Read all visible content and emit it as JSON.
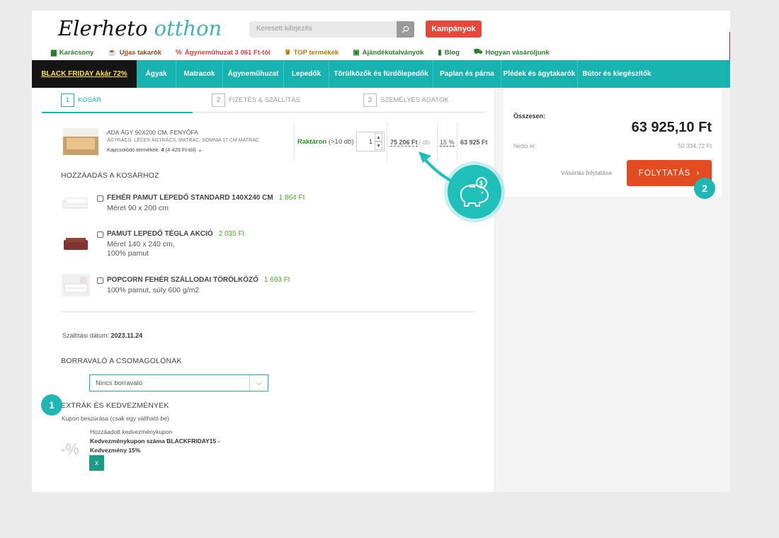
{
  "header": {
    "logo_part1": "Elerheto",
    "logo_part2": "otthon",
    "search_placeholder": "Keresett kifejezés",
    "campaign_label": "Kampányok"
  },
  "quicklinks": [
    {
      "label": "Karácsony",
      "icon": "gift-box-icon",
      "color": "#2a7d2a"
    },
    {
      "label": "Ujjas takarók",
      "icon": "mug-icon",
      "color": "#8a4b14"
    },
    {
      "label": "Ágyneműhuzat 3 061 Ft-tól",
      "icon": "percent-icon",
      "color": "#e53b3b"
    },
    {
      "label": "TOP termékek",
      "icon": "trophy-icon",
      "color": "#b07b00"
    },
    {
      "label": "Ajándékutalványok",
      "icon": "gift-icon",
      "color": "#2a7d2a"
    },
    {
      "label": "Blog",
      "icon": "book-icon",
      "color": "#2a7d2a"
    },
    {
      "label": "Hogyan vásároljunk",
      "icon": "truck-icon",
      "color": "#2a7d2a"
    }
  ],
  "nav": [
    {
      "label": "BLACK FRIDAY Akár 72%",
      "highlight": true
    },
    {
      "label": "Ágyak"
    },
    {
      "label": "Matracok"
    },
    {
      "label": "Ágyneműhuzat"
    },
    {
      "label": "Lepedők"
    },
    {
      "label": "Törülközők és fürdőlepedők"
    },
    {
      "label": "Paplan és párna"
    },
    {
      "label": "Plédek és ágytakarók"
    },
    {
      "label": "Bútor és kiegészítők"
    }
  ],
  "steps": [
    {
      "num": "1",
      "label": "KOSÁR",
      "active": true
    },
    {
      "num": "2",
      "label": "FIZETÉS & SZÁLLÍTÁS",
      "active": false
    },
    {
      "num": "3",
      "label": "SZEMÉLYES ADATOK",
      "active": false
    }
  ],
  "cart_item": {
    "title": "ADA ÁGY 90X200 CM, FENYŐFA",
    "subtitle": "ÁGYRÁCS: LÉCES ÁGYRÁCS, MATRAC: SOMNIA 17 CM MATRAC",
    "related_prefix": "Kapcsolódó termékek:",
    "related_count": "4",
    "related_suffix": "(4 429 Ft-tól)",
    "stock_label": "Raktáron",
    "stock_detail": "(>10 db)",
    "quantity": "1",
    "unit_price": "75 206 Ft",
    "unit": "/ db",
    "discount": "15 %",
    "total": "63 925 Ft"
  },
  "addons_title": "HOZZÁADÁS A KOSÁRHOZ",
  "addons": [
    {
      "name": "FEHÉR PAMUT LEPEDŐ STANDARD 140X240 CM",
      "price": "1 864 Ft",
      "desc": "Méret 90 x 200 cm"
    },
    {
      "name": "PAMUT LEPEDŐ TÉGLA AKCIÓ",
      "price": "2 035 Ft",
      "desc1": "Méret 140 x 240 cm,",
      "desc2": "100% pamut"
    },
    {
      "name": "POPCORN FEHÉR SZÁLLODAI TÖRÖLKÖZŐ",
      "price": "1 693 Ft",
      "desc": "100% pamut, súly 600 g/m2"
    }
  ],
  "shipping": {
    "label": "Szállítási dátum:",
    "date": "2023.11.24"
  },
  "tip": {
    "title": "BORRAVALÓ A CSOMAGOLÓNAK",
    "selected": "Nincs borravaló"
  },
  "extras": {
    "title": "EXTRÁK ÉS KEDVEZMÉNYEK",
    "hint": "Kupon beszúrása (csak egy váltható be)",
    "percent_symbol": "-%",
    "added_label": "Hozzáadott kedvezménykupon",
    "coupon_line1": "Kedvezménykupon száma BLACKFRIDAY15 -",
    "coupon_line2": "Kedvezmény 15%",
    "remove_label": "x"
  },
  "summary": {
    "total_label": "Összesen:",
    "total": "63 925,10 Ft",
    "net_label": "Nettó ár:",
    "net_value": "50 334,72 Ft",
    "continue_label": "Vásárlás folytatása",
    "checkout_label": "FOLYTATÁS"
  },
  "badges": {
    "one": "1",
    "two": "2"
  },
  "colors": {
    "accent": "#18b2b0",
    "checkout": "#e24c20",
    "campaign": "#e8473b",
    "price_green": "#4aa52e"
  }
}
